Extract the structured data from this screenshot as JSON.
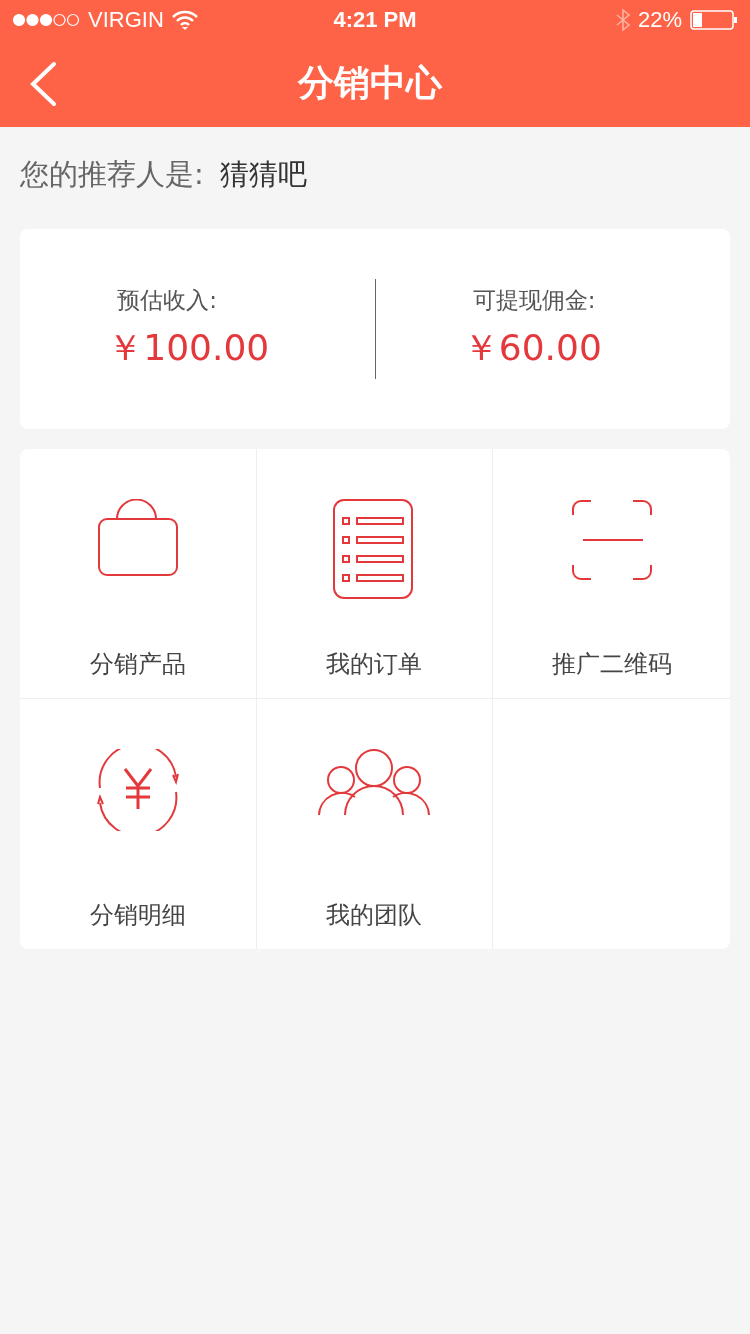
{
  "status_bar": {
    "carrier": "VIRGIN",
    "time": "4:21 PM",
    "battery": "22%"
  },
  "nav": {
    "title": "分销中心"
  },
  "referrer": {
    "label": "您的推荐人是:",
    "name": "猜猜吧"
  },
  "summary": [
    {
      "label": "预估收入:",
      "amount": "￥100.00"
    },
    {
      "label": "可提现佣金:",
      "amount": "￥60.00"
    }
  ],
  "menu": [
    {
      "kind": "bag",
      "label": "分销产品"
    },
    {
      "kind": "list",
      "label": "我的订单"
    },
    {
      "kind": "scan",
      "label": "推广二维码"
    },
    {
      "kind": "yuan",
      "label": "分销明细"
    },
    {
      "kind": "team",
      "label": "我的团队"
    }
  ]
}
